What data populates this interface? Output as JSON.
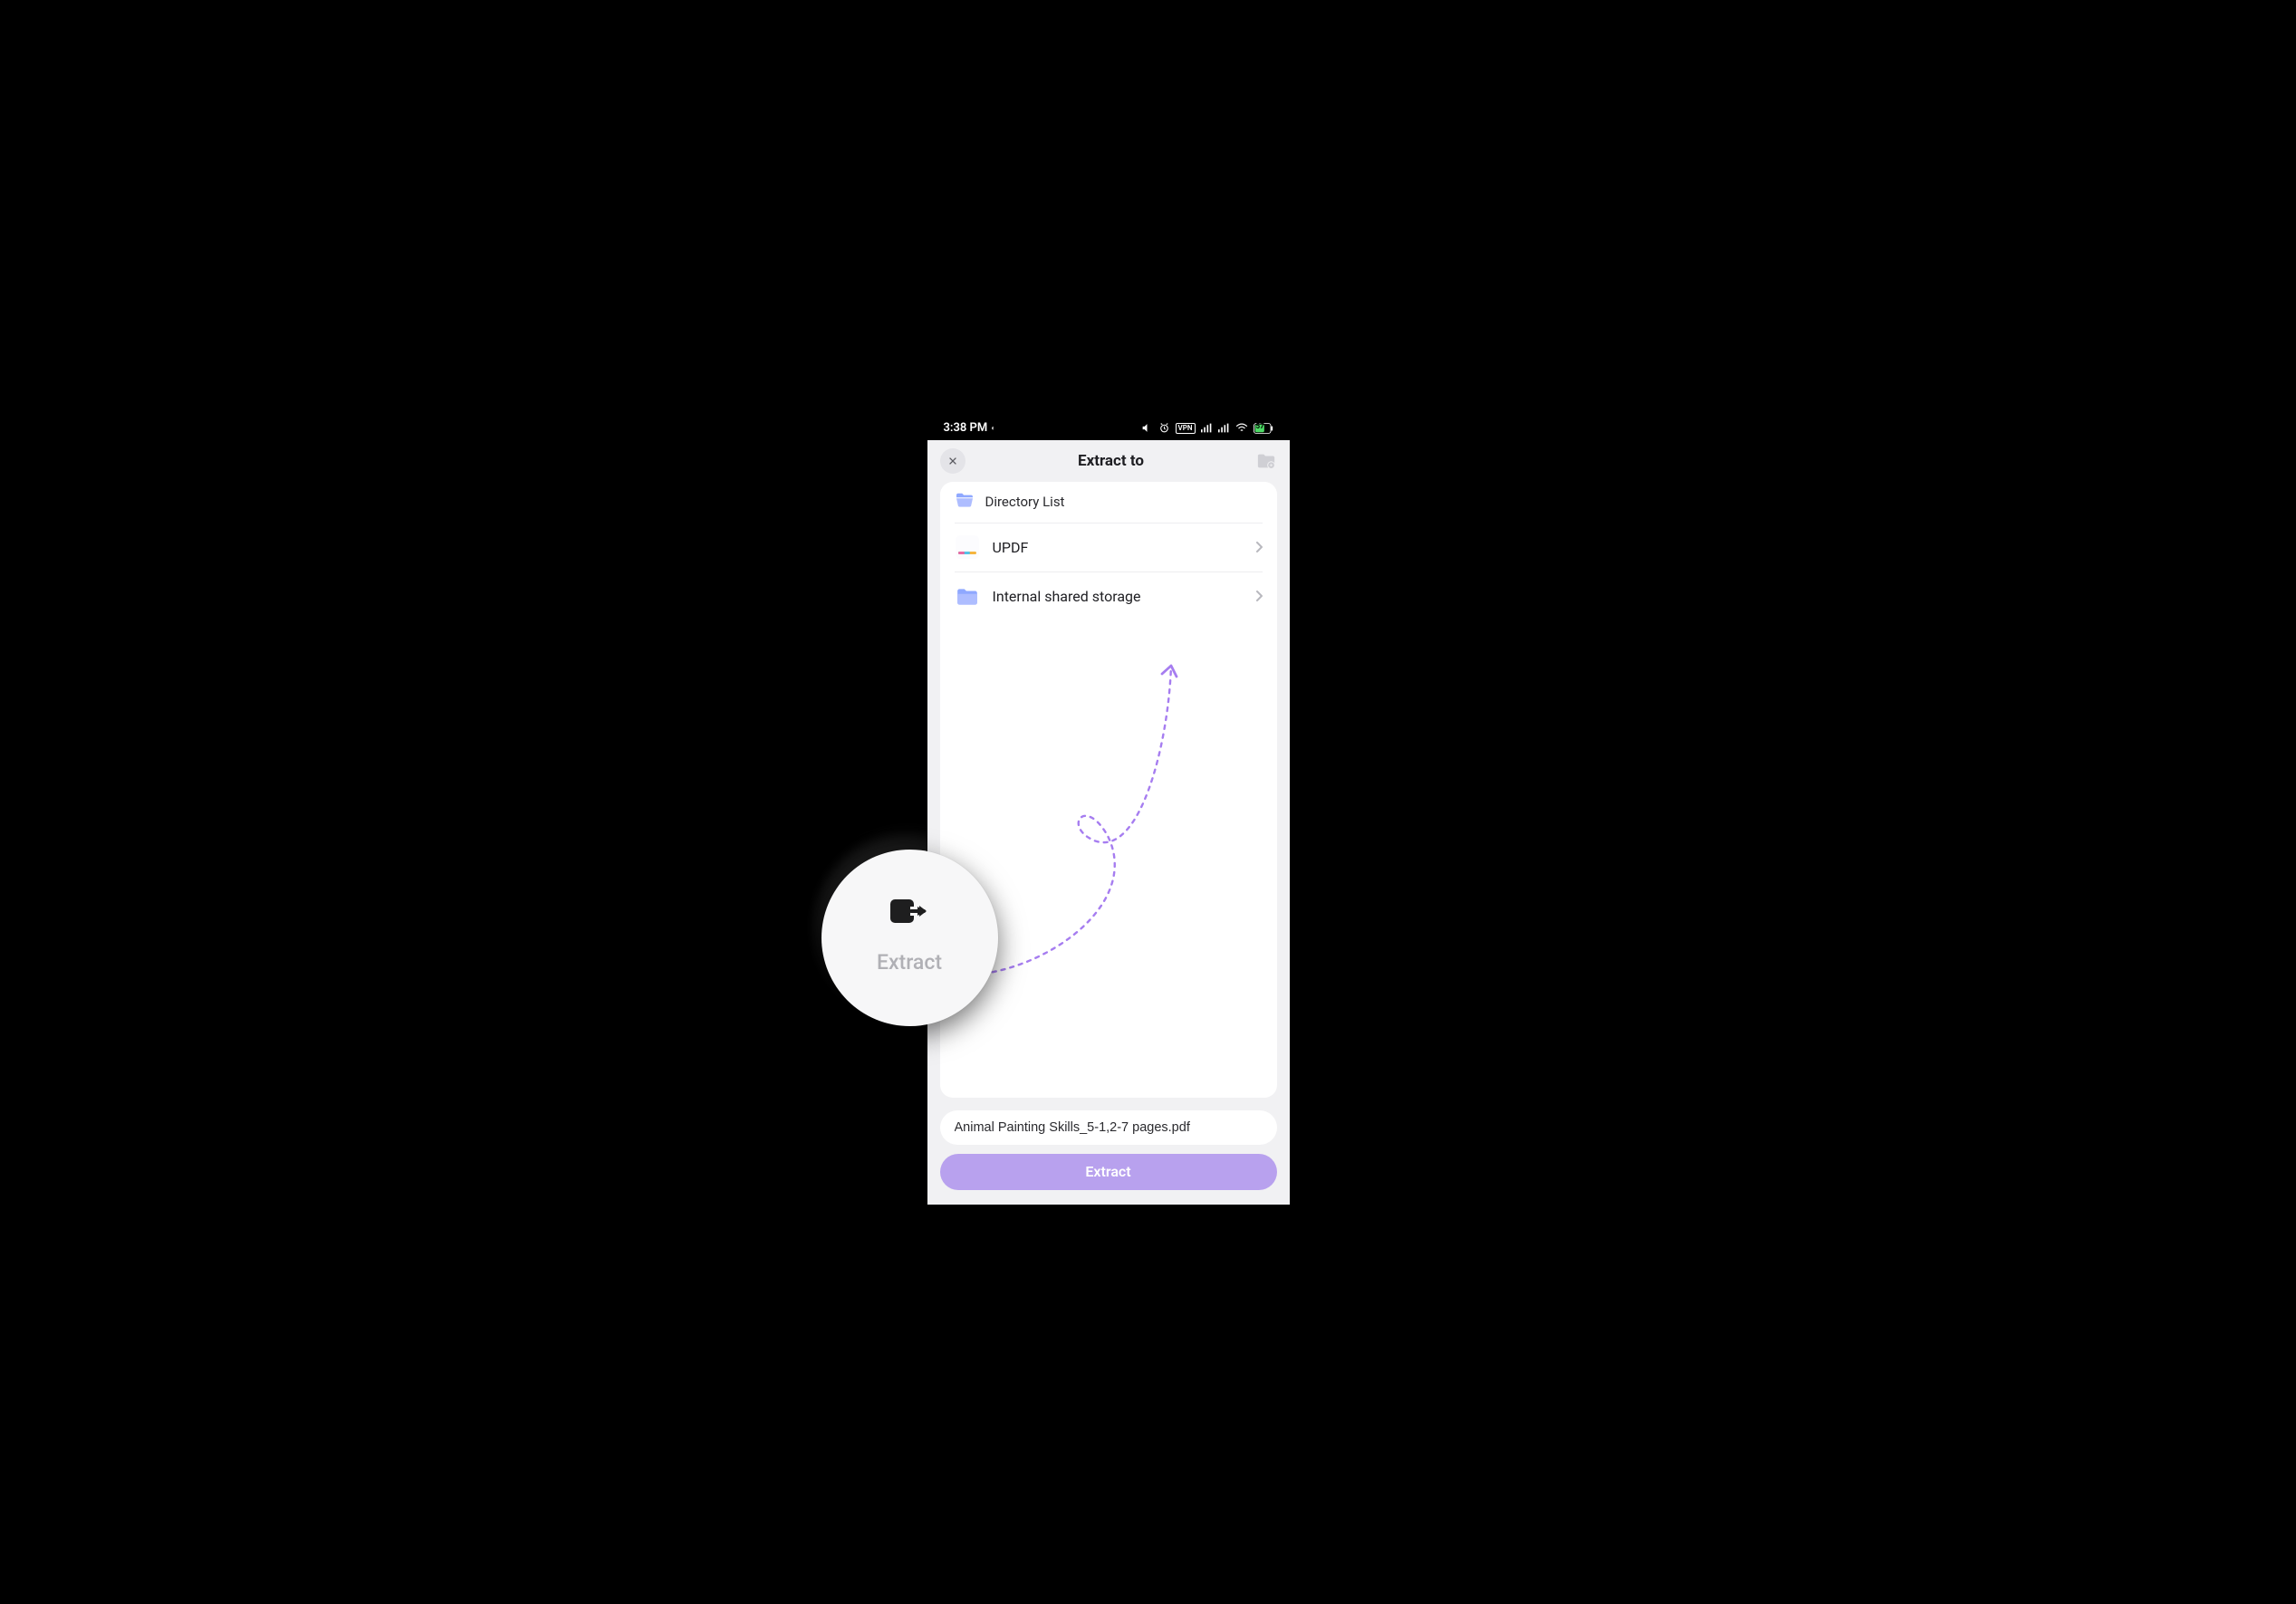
{
  "status": {
    "time": "3:38 PM",
    "vpn_label": "VPN",
    "battery_pct": "57"
  },
  "topbar": {
    "title": "Extract to"
  },
  "panel": {
    "header_label": "Directory List",
    "items": [
      {
        "name": "UPDF"
      },
      {
        "name": "Internal shared storage"
      }
    ]
  },
  "file_field": {
    "value": "Animal Painting Skills_5-1,2-7 pages.pdf"
  },
  "primary_button": {
    "label": "Extract"
  },
  "callout": {
    "label": "Extract"
  },
  "colors": {
    "accent": "#b8a1ee",
    "arrow": "#a67df0"
  }
}
